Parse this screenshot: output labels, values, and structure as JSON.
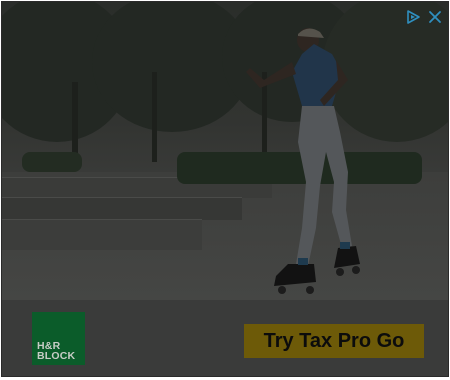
{
  "ad": {
    "brand_logo_lines": [
      "H&R",
      "BLOCK"
    ],
    "cta_label": "Try Tax Pro Go",
    "colors": {
      "logo_bg": "#0b5c2a",
      "cta_bg": "#6d5a08",
      "overlay": "#1b1c1b"
    },
    "icons": {
      "adchoices": "adchoices-icon",
      "close": "close-icon"
    }
  }
}
